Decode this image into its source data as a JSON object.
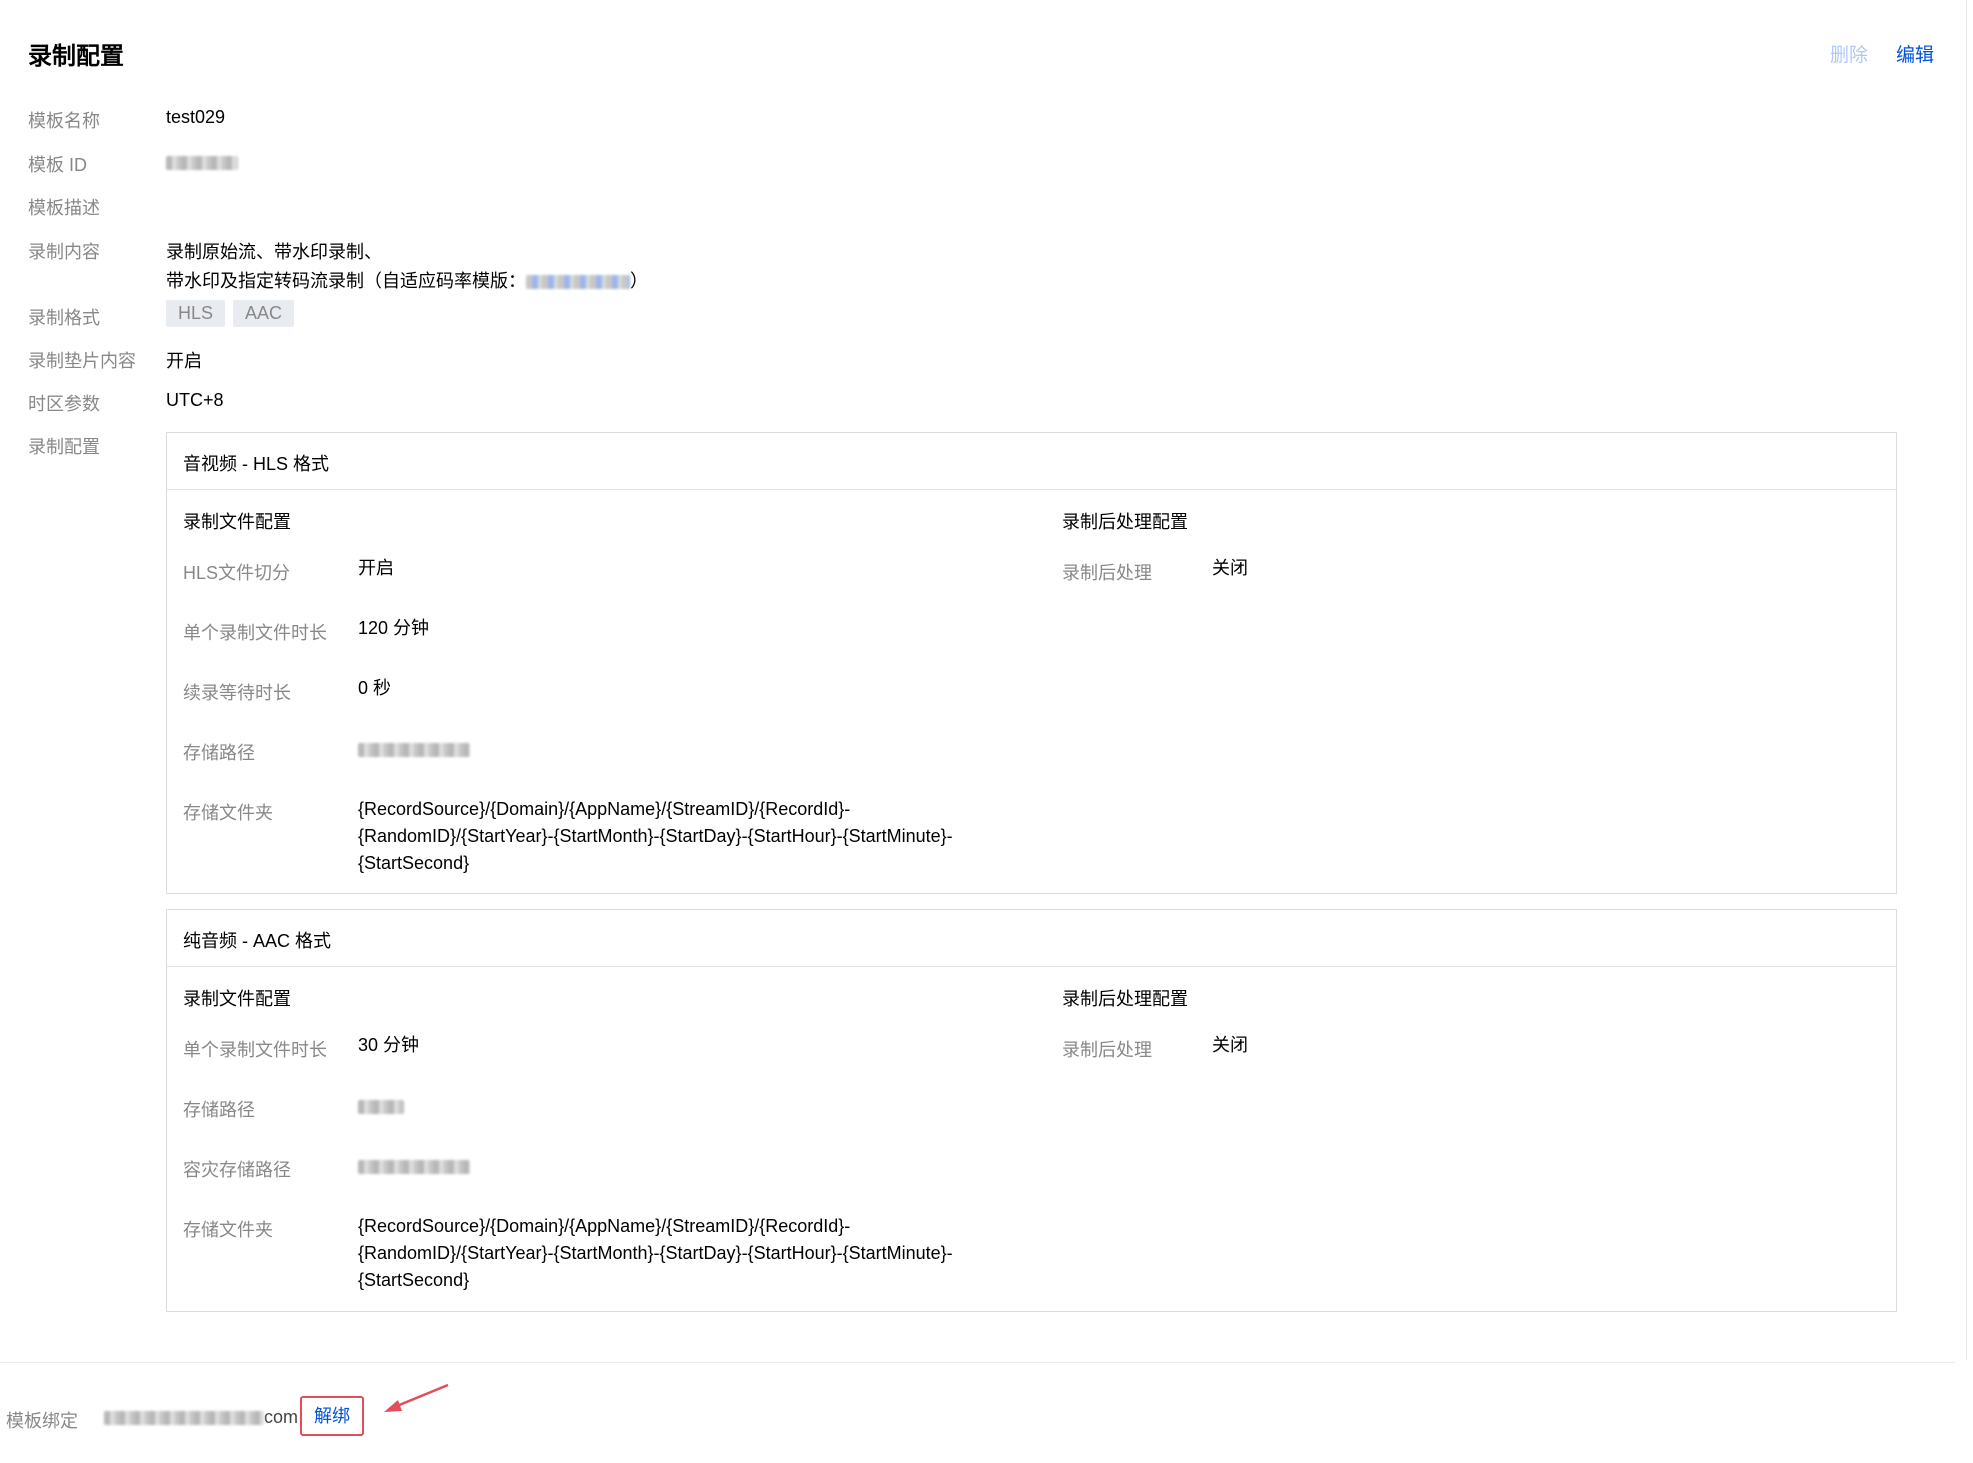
{
  "header": {
    "title": "录制配置",
    "delete_label": "删除",
    "edit_label": "编辑"
  },
  "info": {
    "template_name_label": "模板名称",
    "template_name_value": "test029",
    "template_id_label": "模板 ID",
    "template_desc_label": "模板描述",
    "content_label": "录制内容",
    "content_line1": "录制原始流、带水印录制、",
    "content_line2_prefix": "带水印及指定转码流录制（自适应码率模版：",
    "content_line2_suffix": "）",
    "format_label": "录制格式",
    "formats": [
      "HLS",
      "AAC"
    ],
    "pad_label": "录制垫片内容",
    "pad_value": "开启",
    "tz_label": "时区参数",
    "tz_value": "UTC+8",
    "record_config_label": "录制配置"
  },
  "hls_card": {
    "title": "音视频 - HLS 格式",
    "file_config_title": "录制文件配置",
    "post_config_title": "录制后处理配置",
    "hls_split_label": "HLS文件切分",
    "hls_split_value": "开启",
    "duration_label": "单个录制文件时长",
    "duration_value": "120 分钟",
    "wait_label": "续录等待时长",
    "wait_value": "0 秒",
    "path_label": "存储路径",
    "folder_label": "存储文件夹",
    "folder_line1": "{RecordSource}/{Domain}/{AppName}/{StreamID}/{RecordId}-",
    "folder_line2": "{RandomID}/{StartYear}-{StartMonth}-{StartDay}-{StartHour}-{StartMinute}-",
    "folder_line3": "{StartSecond}",
    "post_label": "录制后处理",
    "post_value": "关闭"
  },
  "aac_card": {
    "title": "纯音频 - AAC 格式",
    "file_config_title": "录制文件配置",
    "post_config_title": "录制后处理配置",
    "duration_label": "单个录制文件时长",
    "duration_value": "30 分钟",
    "path_label": "存储路径",
    "backup_path_label": "容灾存储路径",
    "folder_label": "存储文件夹",
    "folder_line1": "{RecordSource}/{Domain}/{AppName}/{StreamID}/{RecordId}-",
    "folder_line2": "{RandomID}/{StartYear}-{StartMonth}-{StartDay}-{StartHour}-{StartMinute}-",
    "folder_line3": "{StartSecond}",
    "post_label": "录制后处理",
    "post_value": "关闭"
  },
  "binding": {
    "label": "模板绑定",
    "domain_suffix": "com",
    "unbind_label": "解绑"
  },
  "colors": {
    "primary": "#0052d9",
    "primary_disabled": "#b1c8f1",
    "annotation_red": "#e34d59",
    "muted_text": "#888888"
  }
}
